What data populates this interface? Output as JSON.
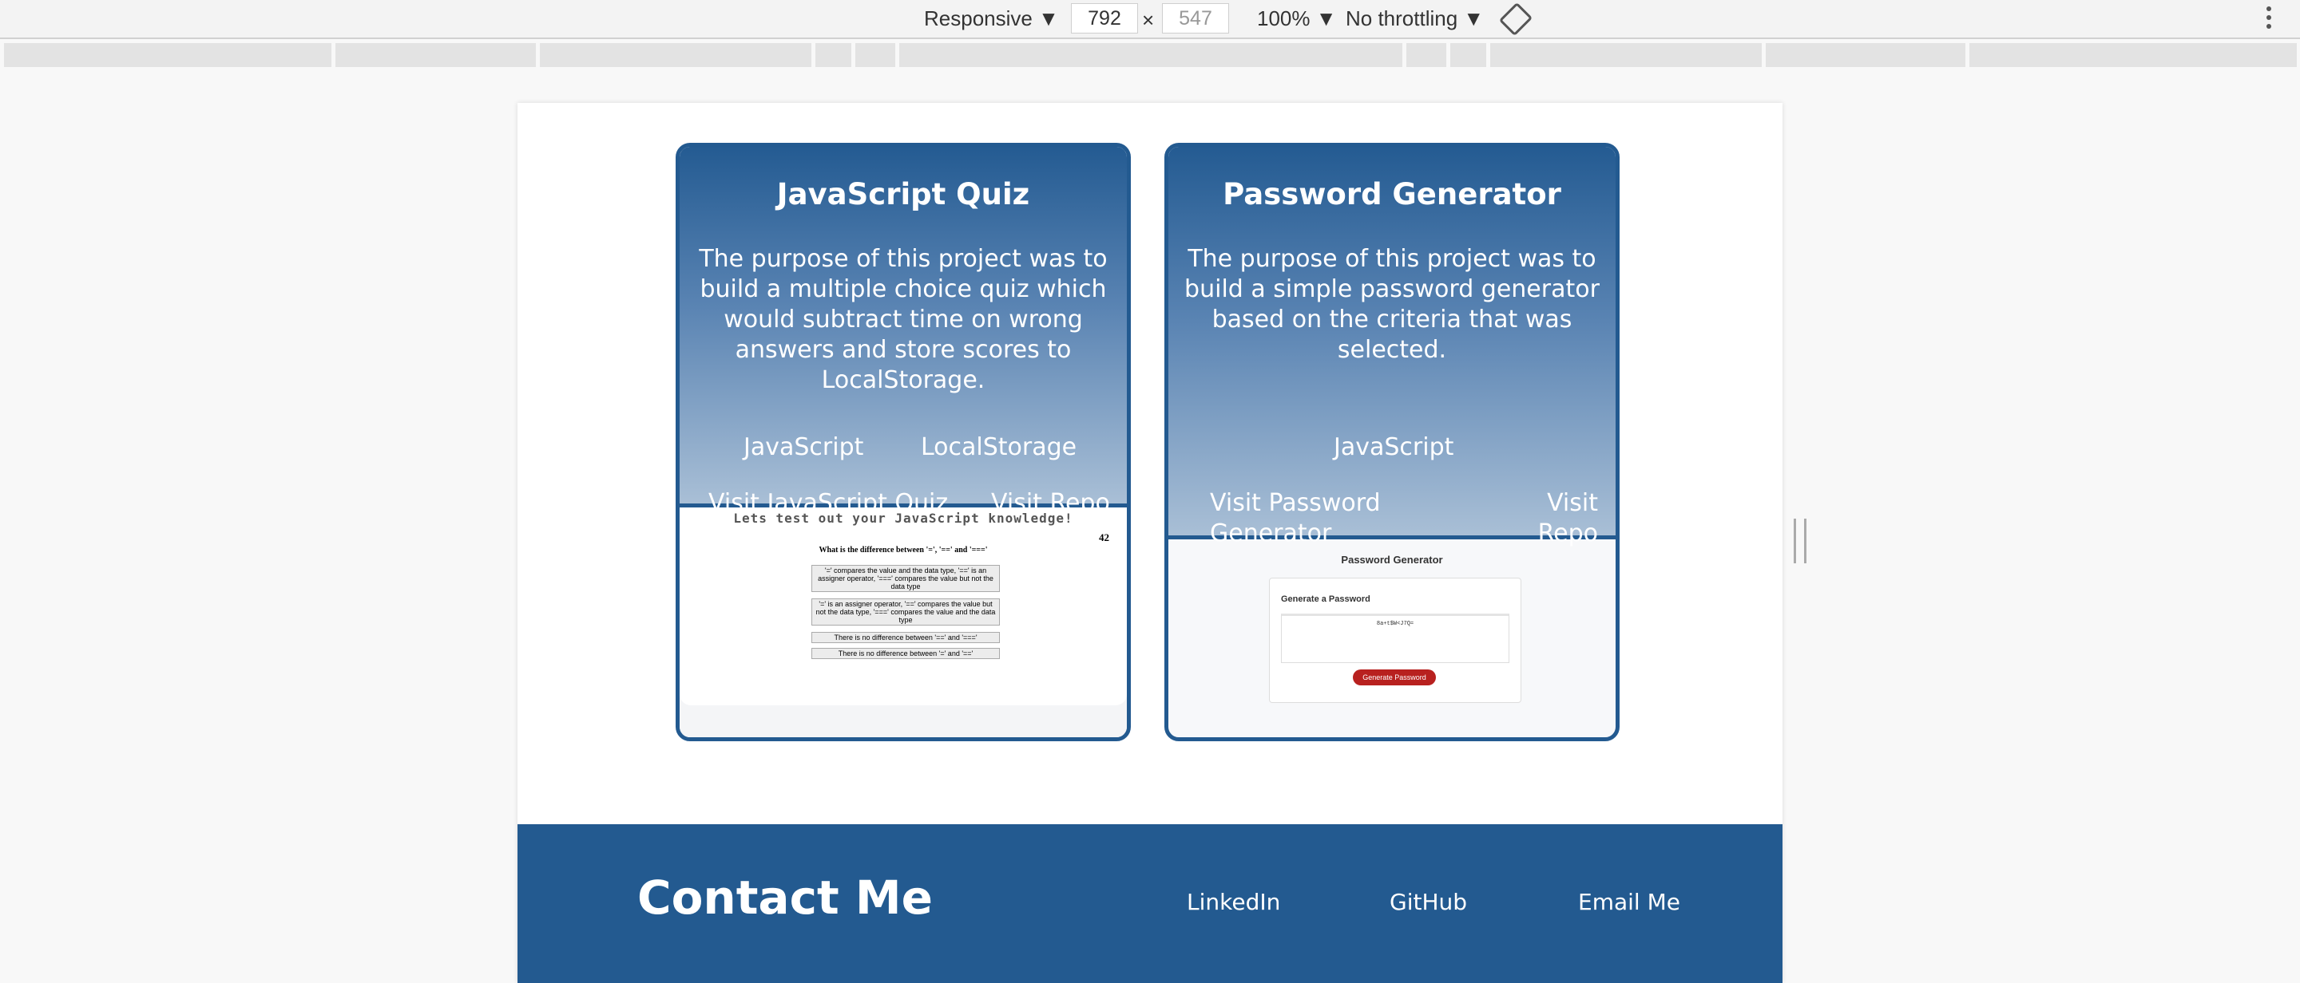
{
  "devtools": {
    "device": "Responsive ▼",
    "width": "792",
    "times": "×",
    "height": "547",
    "zoom": "100% ▼",
    "throttling": "No throttling ▼"
  },
  "projects": [
    {
      "title": "JavaScript Quiz",
      "description": "The purpose of this project was to build a multiple choice quiz which would subtract time on wrong answers and store scores to LocalStorage.",
      "tags": [
        "JavaScript",
        "LocalStorage"
      ],
      "visit_label": "Visit JavaScript Quiz",
      "repo_label": "Visit Repo",
      "preview": {
        "heading": "Lets test out your JavaScript knowledge!",
        "timer": "42",
        "question": "What is the difference between '=', '==' and '==='",
        "options": [
          "'=' compares the value and the data type, '==' is an assigner operator, '===' compares the value but not the data type",
          "'=' is an assigner operator, '==' compares the value but not the data type, '===' compares the value and the data type",
          "There is no difference between '==' and '==='",
          "There is no difference between '=' and '=='"
        ]
      }
    },
    {
      "title": "Password Generator",
      "description": "The purpose of this project was to build a simple password generator based on the criteria that was selected.",
      "tags": [
        "JavaScript"
      ],
      "visit_label": "Visit Password Generator",
      "repo_label": "Visit Repo",
      "preview": {
        "heading": "Password Generator",
        "subheading": "Generate a Password",
        "value": "8a+t$W<J7Q=",
        "button": "Generate Password"
      }
    }
  ],
  "footer": {
    "title": "Contact Me",
    "links": [
      "LinkedIn",
      "GitHub",
      "Email Me"
    ]
  }
}
